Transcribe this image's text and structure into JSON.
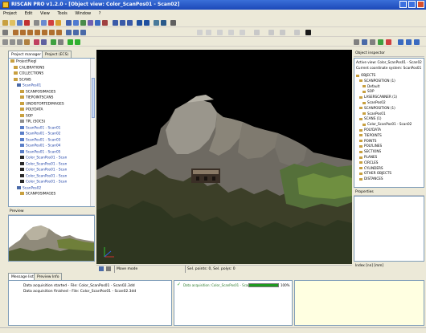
{
  "window": {
    "title": "RISCAN PRO v1.2.0 - [Object view: Color_ScanPos01 - Scan02]"
  },
  "menu": [
    "Project",
    "Edit",
    "View",
    "Tools",
    "Window",
    "?"
  ],
  "left_panel": {
    "tabs": [
      "Project manager",
      "Project (ECS)"
    ],
    "tree": [
      {
        "label": "ProjectRiegl",
        "blue": false
      },
      {
        "label": "CALIBRATIONS",
        "blue": false
      },
      {
        "label": "COLLECTIONS",
        "blue": false
      },
      {
        "label": "SCANS",
        "blue": false
      },
      {
        "label": "ScanPos01",
        "blue": true
      },
      {
        "label": "SCANPOSIMAGES",
        "blue": false
      },
      {
        "label": "TIEPOINTSCANS",
        "blue": false
      },
      {
        "label": "UNDISTORTEDIMAGES",
        "blue": false
      },
      {
        "label": "POLYDATA",
        "blue": false
      },
      {
        "label": "SOP",
        "blue": false
      },
      {
        "label": "TPL (SOCS)",
        "blue": false
      },
      {
        "label": "ScanPos01 - Scan01",
        "blue": true
      },
      {
        "label": "ScanPos01 - Scan02",
        "blue": true
      },
      {
        "label": "ScanPos01 - Scan03",
        "blue": true
      },
      {
        "label": "ScanPos01 - Scan04",
        "blue": true
      },
      {
        "label": "ScanPos01 - Scan05",
        "blue": true
      },
      {
        "label": "Color_ScanPos01 - Scan",
        "blue": true
      },
      {
        "label": "Color_ScanPos01 - Scan",
        "blue": true
      },
      {
        "label": "Color_ScanPos01 - Scan",
        "blue": true
      },
      {
        "label": "Color_ScanPos01 - Scan",
        "blue": true
      },
      {
        "label": "Color_ScanPos01 - Scan",
        "blue": true
      },
      {
        "label": "ScanPos02",
        "blue": true
      },
      {
        "label": "SCANPOSIMAGES",
        "blue": false
      }
    ],
    "preview_title": "Preview"
  },
  "viewport": {
    "status_mode": "Move mode",
    "status_info": "Sel. points: 0, Sel. polys: 0"
  },
  "right_panel": {
    "title": "Object inspector",
    "active_row": "Active view: Color_ScanPos01 - Scan02",
    "coord_row": "Current coordinate system: ScanPos01",
    "tree": [
      "OBJECTS",
      "SCANPOSITION (1)",
      "Default",
      "SOP",
      "LASERSCANNER (1)",
      "ScanPos02",
      "SCANPOSITION (1)",
      "ScanPos01",
      "SCANS (1)",
      "Color_ScanPos01 - Scan02",
      "POLYDATA",
      "TIEPOINTS",
      "POINTS",
      "POLYLINES",
      "SECTIONS",
      "PLANES",
      "CIRCLES",
      "CYLINDERS",
      "OTHER OBJECTS",
      "DISTANCES"
    ],
    "props_title": "Properties",
    "props_footer": "Index [nn] [mm]"
  },
  "bottom": {
    "tabs": [
      "Message list",
      "Preview Info"
    ],
    "messages": [
      "Data acquisition started - File: Color_ScanPos01 - Scan02.3dd",
      "Data acquisition finished - File: Color_ScanPos01 - Scan02.3dd"
    ],
    "task_label": "Data acquisition: Color_ScanPos01 - Scan02",
    "task_progress": 1.0,
    "task_percent": "100%"
  }
}
